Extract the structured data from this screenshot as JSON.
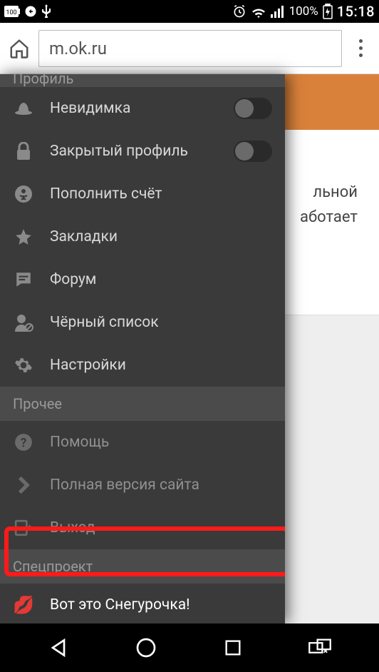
{
  "status": {
    "battery_small": "100",
    "battery_pct": "100%",
    "clock": "15:18"
  },
  "browser": {
    "url": "m.ok.ru"
  },
  "behind": {
    "line1": "льной",
    "line2": "аботает"
  },
  "drawer": {
    "header_profile": "Профиль",
    "invisible": "Невидимка",
    "closed_profile": "Закрытый профиль",
    "topup": "Пополнить счёт",
    "bookmarks": "Закладки",
    "forum": "Форум",
    "blacklist": "Чёрный список",
    "settings": "Настройки",
    "header_other": "Прочее",
    "help": "Помощь",
    "full_site": "Полная версия сайта",
    "logout": "Выход",
    "header_special": "Спецпроект",
    "snegurochka": "Вот это Снегурочка!"
  }
}
